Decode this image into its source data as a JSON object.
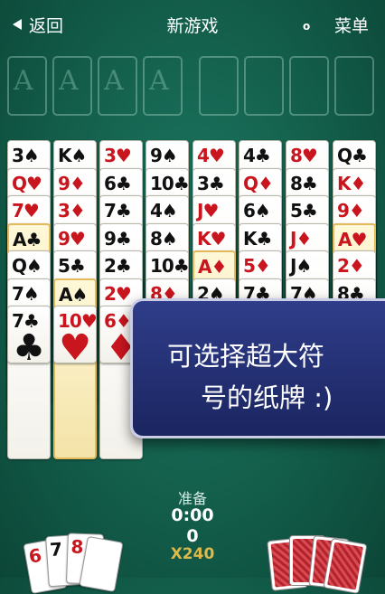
{
  "nav": {
    "back_label": "返回",
    "title": "新游戏",
    "count": "o",
    "menu_label": "菜单"
  },
  "foundations": [
    {
      "ghost": "A"
    },
    {
      "ghost": "A"
    },
    {
      "ghost": "A"
    },
    {
      "ghost": "A"
    }
  ],
  "free_cells": [
    {},
    {},
    {},
    {}
  ],
  "columns": [
    [
      "3♠",
      "Q♥",
      "7♥",
      "A♣",
      "Q♠",
      "7♠",
      "7♣"
    ],
    [
      "K♠",
      "9♦",
      "3♦",
      "9♥",
      "5♣",
      "A♠",
      "10♥"
    ],
    [
      "3♥",
      "6♣",
      "7♣",
      "9♣",
      "2♣",
      "2♥",
      "6♦"
    ],
    [
      "9♠",
      "10♣",
      "4♠",
      "8♠",
      "10♣",
      "8♦"
    ],
    [
      "4♥",
      "3♣",
      "J♥",
      "K♥",
      "A♦",
      "2♠"
    ],
    [
      "4♣",
      "Q♦",
      "6♠",
      "K♣",
      "5♦",
      "7♣"
    ],
    [
      "8♥",
      "8♣",
      "5♣",
      "J♦",
      "J♠",
      "7♠"
    ],
    [
      "Q♣",
      "K♦",
      "9♦",
      "A♥",
      "2♦",
      "8♣"
    ]
  ],
  "highlighted": [
    {
      "col": 0,
      "row": 3
    },
    {
      "col": 1,
      "row": 5
    },
    {
      "col": 4,
      "row": 4
    },
    {
      "col": 7,
      "row": 3
    }
  ],
  "big_suits": [
    "♣",
    "♥",
    "♦"
  ],
  "promo": {
    "line1": "可选择超大符",
    "line2": "号的纸牌 :)"
  },
  "status": {
    "label": "准备",
    "time": "0:00",
    "score": "0",
    "multiplier": "X240"
  },
  "hand": [
    "6",
    "7",
    "8"
  ],
  "colors": {
    "felt": "#135e4b",
    "red_suit": "#c9151e",
    "promo_bg": "#1b2560",
    "multiplier": "#ddb94a"
  }
}
